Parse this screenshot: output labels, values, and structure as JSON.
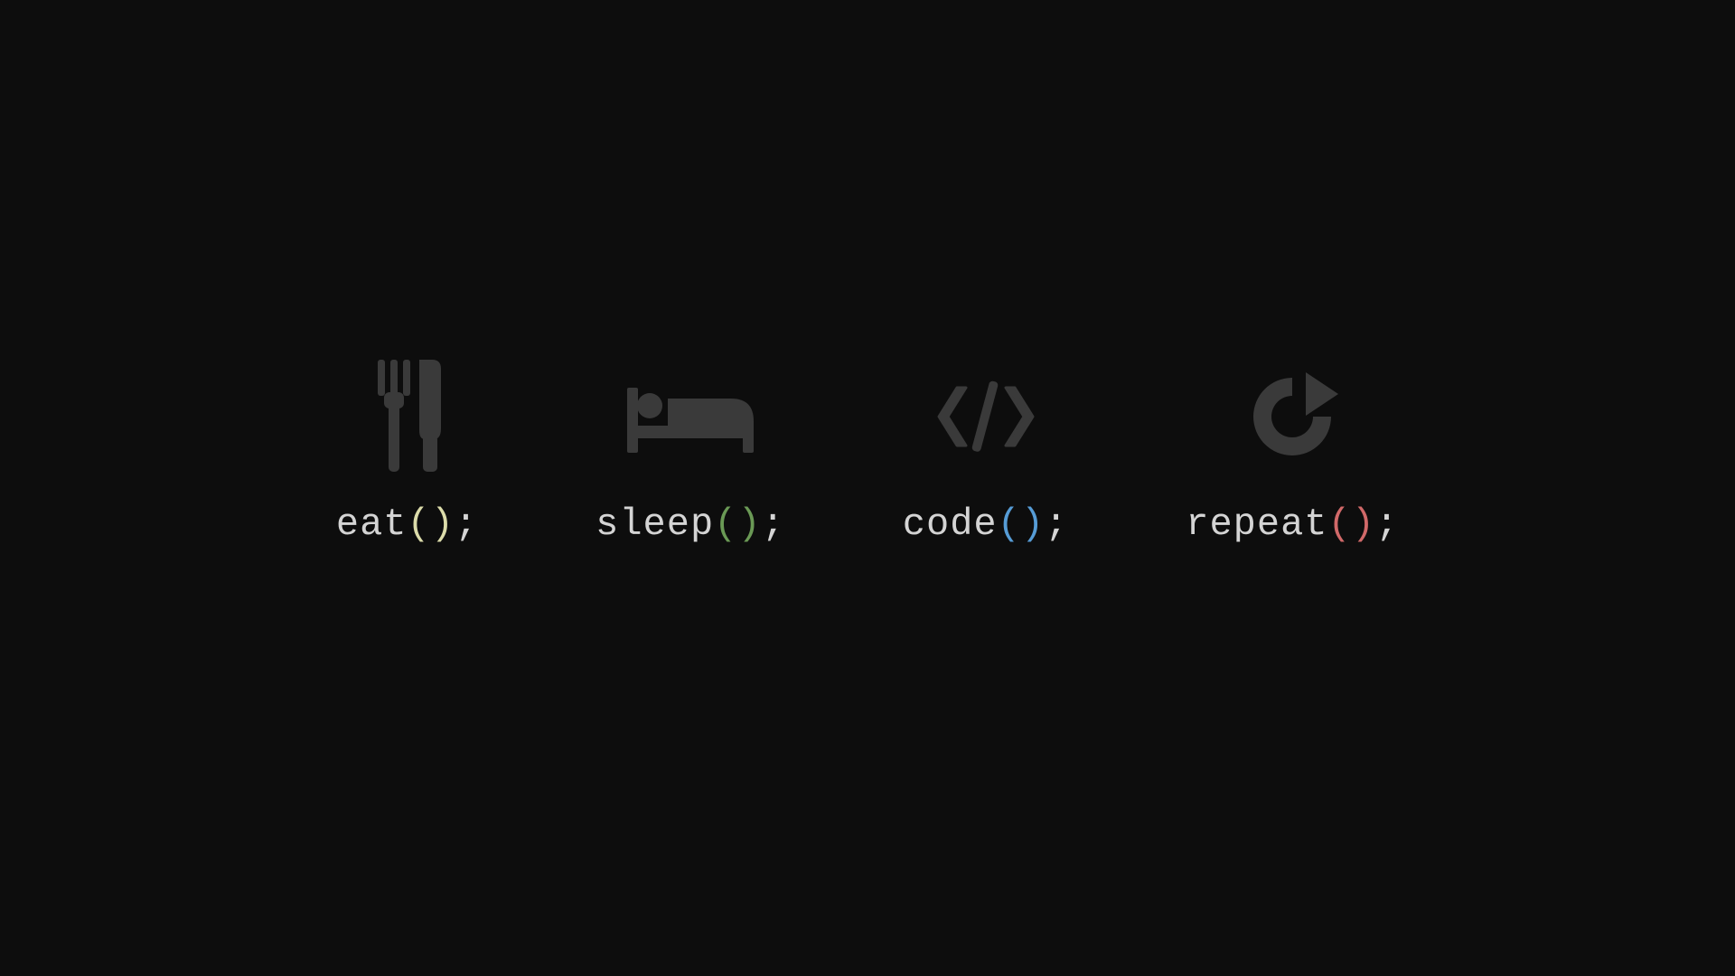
{
  "items": [
    {
      "name": "eat",
      "parens": "()",
      "semi": ";",
      "parenColor": "#dcdcaa",
      "icon": "fork-knife-icon"
    },
    {
      "name": "sleep",
      "parens": "()",
      "semi": ";",
      "parenColor": "#6a9955",
      "icon": "bed-icon"
    },
    {
      "name": "code",
      "parens": "()",
      "semi": ";",
      "parenColor": "#569cd6",
      "icon": "code-icon"
    },
    {
      "name": "repeat",
      "parens": "()",
      "semi": ";",
      "parenColor": "#d16969",
      "icon": "redo-icon"
    }
  ],
  "colors": {
    "background": "#0d0d0d",
    "iconFill": "#3a3a3a",
    "textColor": "#d4d4d4"
  }
}
